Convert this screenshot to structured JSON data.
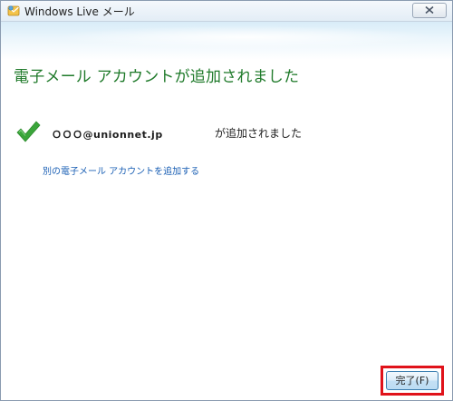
{
  "window": {
    "title": "Windows Live メール",
    "icon": "windows-live-mail-icon",
    "close_icon": "close-icon"
  },
  "main": {
    "heading": "電子メール アカウントが追加されました",
    "status_icon": "green-checkmark-icon",
    "account_email": "ＯＯＯ@unionnet.jp",
    "added_text": "が追加されました",
    "add_another_link": "別の電子メール アカウントを追加する"
  },
  "footer": {
    "done_button_label": "完了(F)"
  },
  "colors": {
    "heading_green": "#1f7a2a",
    "link_blue": "#1a5fb4",
    "highlight_red": "#e0121a",
    "check_green": "#3aa53a"
  }
}
